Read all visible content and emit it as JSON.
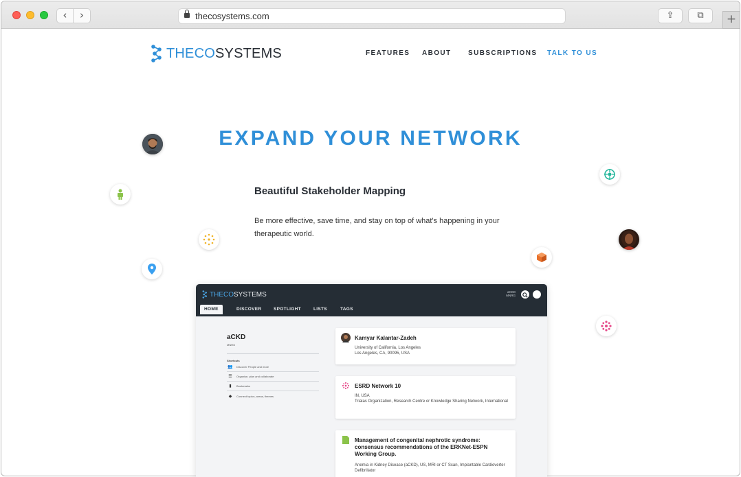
{
  "browser": {
    "url": "thecosystems.com",
    "back_glyph": "‹",
    "forward_glyph": "›",
    "share_glyph": "⇪",
    "tabs_glyph": "⧉",
    "newtab_glyph": "+"
  },
  "site": {
    "brand_part1": "THECO",
    "brand_part2": "SYSTEMS",
    "brand_color": "#2f8fd8",
    "nav": {
      "features": "FEATURES",
      "about": "ABOUT",
      "subscriptions": "SUBSCRIPTIONS",
      "talk": "TALK TO US"
    }
  },
  "hero": {
    "title": "EXPAND YOUR NETWORK",
    "subtitle": "Beautiful Stakeholder Mapping",
    "text": "Be more effective, save time, and stay on top of what's happening in your therapeutic world."
  },
  "app": {
    "brand_part1": "THECO",
    "brand_part2": "SYSTEMS",
    "user_line1": "aCKD",
    "user_line2": "MNRG",
    "tabs": [
      "HOME",
      "DISCOVER",
      "SPOTLIGHT",
      "LISTS",
      "TAGS"
    ],
    "sidebar": {
      "title": "aCKD",
      "subtitle": "MNRG",
      "shortcuts_label": "Shortcuts",
      "items": [
        {
          "icon": "people-icon",
          "label": "Discover People and more"
        },
        {
          "icon": "list-icon",
          "label": "Organise, plan and collaborate"
        },
        {
          "icon": "bookmark-icon",
          "label": "Bookmarks"
        },
        {
          "icon": "tag-icon",
          "label": "Connect topics, areas, themes"
        }
      ]
    },
    "cards": [
      {
        "title": "Kamyar Kalantar-Zadeh",
        "lines": [
          "University of California, Los Angeles",
          "Los Angeles, CA, 90095, USA"
        ]
      },
      {
        "title": "ESRD Network 10",
        "lines": [
          "IN, USA",
          "Trialas Organization, Research Centre or Knowledge Sharing Network, International"
        ]
      },
      {
        "title": "Management of congenital nephrotic syndrome: consensus recommendations of the ERKNet-ESPN Working Group.",
        "lines": [
          "Anemia in Kidney Disease (aCKD), US, MRI or CT Scan, Implantable Cardioverter Defibrillator"
        ]
      }
    ]
  }
}
